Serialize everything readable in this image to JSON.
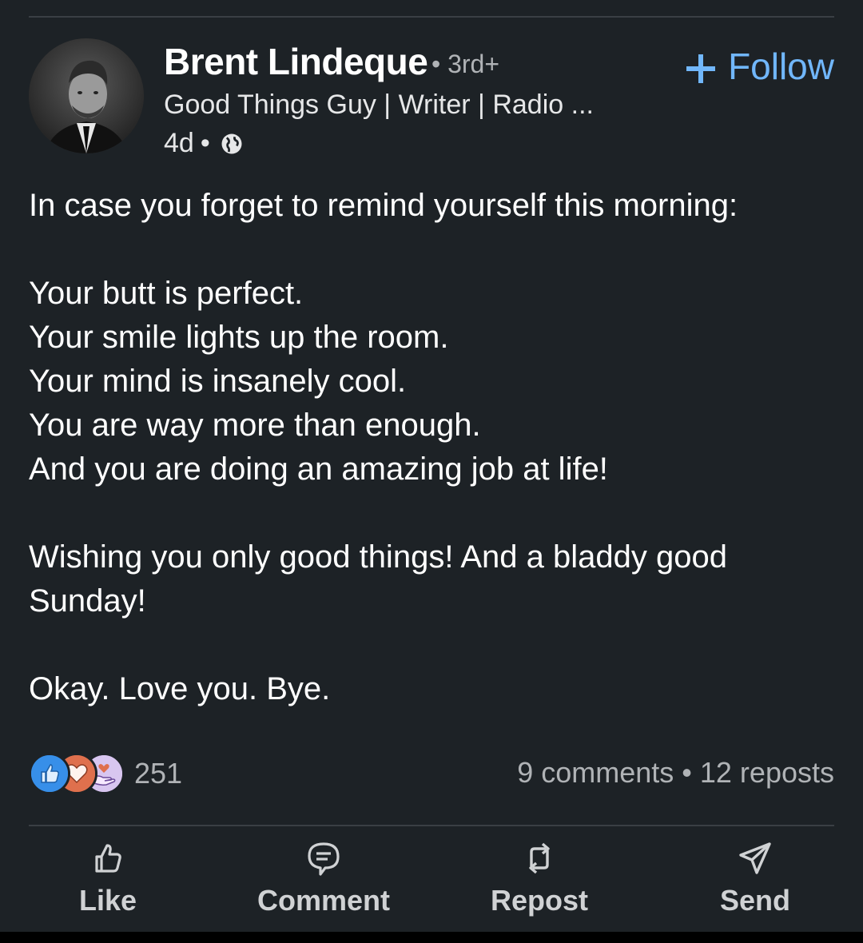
{
  "post": {
    "author_name": "Brent Lindeque",
    "degree": "• 3rd+",
    "headline": "Good Things Guy | Writer | Radio ...",
    "time": "4d",
    "time_separator": "•",
    "follow_label": "Follow",
    "body": {
      "intro": "In case you forget to remind yourself this morning:",
      "affirmations": [
        "Your butt is perfect.",
        "Your smile lights up the room.",
        "Your mind is insanely cool.",
        "You are way more than enough.",
        "And you are doing an amazing job at life!"
      ],
      "wishes": "Wishing you only good things! And a bladdy good Sunday!",
      "signoff": "Okay. Love you. Bye."
    },
    "reactions": {
      "icons": [
        "like-reaction-icon",
        "love-reaction-icon",
        "support-reaction-icon"
      ],
      "count": "251"
    },
    "comments": "9 comments",
    "separator": "•",
    "reposts": "12 reposts"
  },
  "actions": {
    "like": "Like",
    "comment": "Comment",
    "repost": "Repost",
    "send": "Send"
  },
  "colors": {
    "background": "#1d2226",
    "accent": "#71b7fb",
    "muted_text": "#b0b3b6"
  }
}
